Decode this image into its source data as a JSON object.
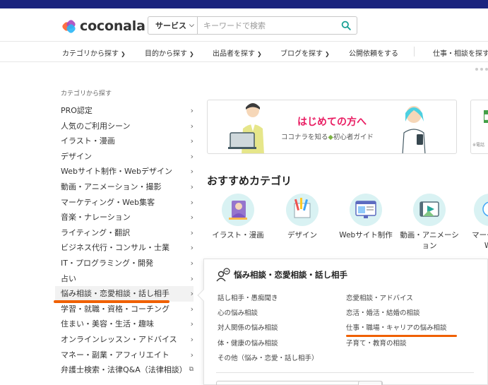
{
  "header": {
    "logo_text": "coconala",
    "search": {
      "select_label": "サービス",
      "placeholder": "キーワードで検索"
    }
  },
  "nav": {
    "items": [
      {
        "label": "カテゴリから探す",
        "has_chevron": true
      },
      {
        "label": "目的から探す",
        "has_chevron": true
      },
      {
        "label": "出品者を探す",
        "has_chevron": true
      },
      {
        "label": "ブログを探す",
        "has_chevron": true
      },
      {
        "label": "公開依頼をする",
        "has_chevron": false
      },
      {
        "label": "仕事・相談を探す",
        "has_chevron": true
      }
    ]
  },
  "sidebar": {
    "title": "カテゴリから探す",
    "items": [
      {
        "label": "PRO認定"
      },
      {
        "label": "人気のご利用シーン"
      },
      {
        "label": "イラスト・漫画"
      },
      {
        "label": "デザイン"
      },
      {
        "label": "Webサイト制作・Webデザイン"
      },
      {
        "label": "動画・アニメーション・撮影"
      },
      {
        "label": "マーケティング・Web集客"
      },
      {
        "label": "音楽・ナレーション"
      },
      {
        "label": "ライティング・翻訳"
      },
      {
        "label": "ビジネス代行・コンサル・士業"
      },
      {
        "label": "IT・プログラミング・開発"
      },
      {
        "label": "占い"
      },
      {
        "label": "悩み相談・恋愛相談・話し相手"
      },
      {
        "label": "学習・就職・資格・コーチング"
      },
      {
        "label": "住まい・美容・生活・趣味"
      },
      {
        "label": "オンラインレッスン・アドバイス"
      },
      {
        "label": "マネー・副業・アフィリエイト"
      },
      {
        "label": "弁護士検索・法律Q&A（法律相談）"
      }
    ]
  },
  "banner": {
    "title": "はじめての方へ",
    "subtitle": "ココナラを知る",
    "subtitle2": "初心者ガイド",
    "banner2_small": "※電話"
  },
  "recommended": {
    "title": "おすすめカテゴリ",
    "categories": [
      {
        "label": "イラスト・漫画",
        "icon": "illustration-icon"
      },
      {
        "label": "デザイン",
        "icon": "design-icon"
      },
      {
        "label": "Webサイト制作",
        "icon": "website-icon"
      },
      {
        "label": "動画・アニメーション",
        "icon": "video-icon"
      },
      {
        "label": "マーケティ\nWe",
        "icon": "marketing-icon"
      }
    ]
  },
  "panel": {
    "title": "悩み相談・恋愛相談・話し相手",
    "left_items": [
      {
        "label": "話し相手・愚痴聞き"
      },
      {
        "label": "心の悩み相談"
      },
      {
        "label": "対人関係の悩み相談"
      },
      {
        "label": "体・健康の悩み相談"
      },
      {
        "label": "その他（悩み・恋愛・話し相手）"
      }
    ],
    "right_items": [
      {
        "label": "恋愛相談・アドバイス"
      },
      {
        "label": "恋活・婚活・結婚の相談"
      },
      {
        "label": "仕事・職場・キャリアの悩み相談"
      },
      {
        "label": "子育て・教育の相談"
      }
    ]
  },
  "colors": {
    "accent_underline": "#f06000",
    "banner_title": "#e91e63",
    "icon_bg": "#d9f2f3",
    "search_icon": "#1aa094"
  }
}
